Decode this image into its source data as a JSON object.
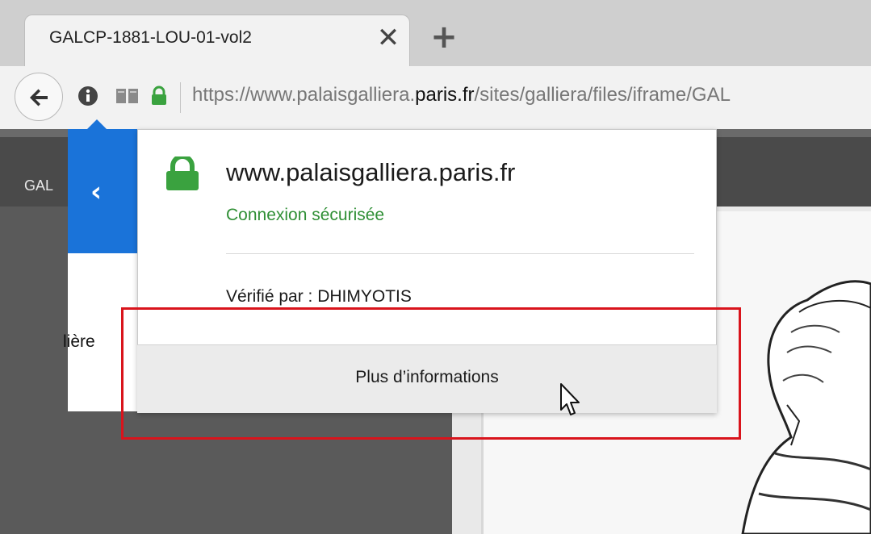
{
  "browser": {
    "tab": {
      "title": "GALCP-1881-LOU-01-vol2",
      "close_glyph": "✕"
    },
    "new_tab_glyph": "+",
    "address_bar": {
      "url_prefix": "https://www.palaisgalliera.",
      "url_host": "paris.fr",
      "url_suffix": "/sites/galliera/files/iframe/GAL"
    }
  },
  "page": {
    "header_text": "GAL",
    "side_text": "lière"
  },
  "site_info_popup": {
    "back_glyph": "‹",
    "host": "www.palaisgalliera.paris.fr",
    "status": "Connexion sécurisée",
    "verified_by": "Vérifié par : DHIMYOTIS",
    "more_info_button": "Plus d’informations"
  },
  "colors": {
    "secure_green": "#2f8f35",
    "lock_green": "#3aa23f",
    "popup_blue": "#1a73d9",
    "highlight_red": "#d9141c"
  },
  "icons": [
    "back-arrow-icon",
    "info-icon",
    "reader-view-icon",
    "lock-icon",
    "cursor-icon"
  ]
}
